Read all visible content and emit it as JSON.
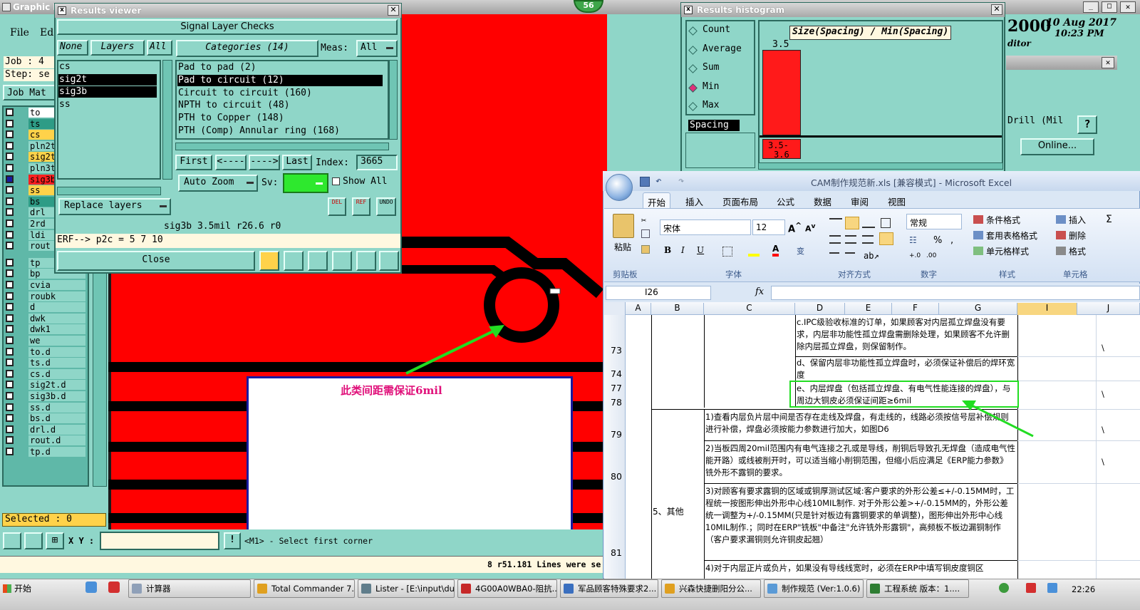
{
  "genesis": {
    "title": "Graphic E",
    "menu": [
      "File",
      "Ed"
    ],
    "job_label": "Job : 4",
    "step_label": "Step: se",
    "job_matrix": "Job Mat",
    "date": "10 Aug 2017",
    "time": "10:23 PM",
    "year_big": "2000",
    "editor": "ditor",
    "drill_label": "Drill (Mil",
    "help": "?",
    "online": "Online...",
    "selected": "Selected : 0",
    "xy_label": "X Y :",
    "prompt": "<M1> - Select first corner",
    "status_msg": "8 r51.181 Lines were se",
    "badge": "56",
    "excl": "!",
    "layers": [
      "to",
      "ts",
      "cs",
      "pln2t",
      "sig2t",
      "pln3t",
      "sig3b",
      "ss",
      "bs",
      "drl",
      "2rd",
      "ldi",
      "rout",
      "tp",
      "bp",
      "cvia",
      "roubk",
      "d",
      "dwk",
      "dwk1",
      "we",
      "to.d",
      "ts.d",
      "cs.d",
      "sig2t.d",
      "sig3b.d",
      "ss.d",
      "bs.d",
      "drl.d",
      "rout.d",
      "tp.d"
    ],
    "layer_colors": [
      "#ffffff",
      "#2e9c86",
      "#ffd24a",
      "#8fd6c8",
      "#ffd24a",
      "#8fd6c8",
      "#ff2020",
      "#ffd24a",
      "#2e9c86",
      "#8fd6c8",
      "#8fd6c8",
      "#8fd6c8",
      "#8fd6c8",
      "#8fd6c8",
      "#8fd6c8",
      "#8fd6c8",
      "#8fd6c8",
      "#8fd6c8",
      "#8fd6c8",
      "#8fd6c8",
      "#8fd6c8",
      "#8fd6c8",
      "#8fd6c8",
      "#8fd6c8",
      "#8fd6c8",
      "#8fd6c8",
      "#8fd6c8",
      "#8fd6c8",
      "#8fd6c8",
      "#8fd6c8",
      "#8fd6c8"
    ],
    "annotation": "此类间距需保证6mil"
  },
  "results": {
    "title": "Results viewer",
    "header": "Signal Layer Checks",
    "none": "None",
    "layers": "Layers",
    "all": "All",
    "categories": "Categories (14)",
    "meas": "Meas:",
    "meas_val": "All",
    "layer_items": [
      "cs",
      "sig2t",
      "sig3b",
      "ss"
    ],
    "cat_items": [
      "Pad to pad (2)",
      "Pad to circuit (12)",
      "Circuit to circuit (160)",
      "NPTH to circuit (48)",
      "PTH to Copper (148)",
      "PTH (Comp) Annular ring (168)"
    ],
    "first": "First",
    "prev": "<----",
    "next": "---->",
    "last": "Last",
    "index_label": "Index:",
    "index_val": "3665",
    "auto_zoom": "Auto Zoom",
    "sv": "Sv:",
    "show_all": "Show All",
    "replace": "Replace layers",
    "del": "DEL",
    "ref": "REF",
    "undo": "UNDO",
    "status": "sig3b 3.5mil  r26.6  r0",
    "erf": "ERF--> p2c = 5 7 10",
    "close": "Close"
  },
  "histogram": {
    "title": "Results histogram",
    "options": [
      "Count",
      "Average",
      "Sum",
      "Min",
      "Max"
    ],
    "selected": "Min",
    "spacing": "Spacing",
    "chart_title": "Size(Spacing) / Min(Spacing)",
    "bar_value": "3.5",
    "bin_label1": "3.5-",
    "bin_label2": "3.6"
  },
  "excel": {
    "title": "CAM制作规范新.xls [兼容模式] - Microsoft Excel",
    "tabs": [
      "开始",
      "插入",
      "页面布局",
      "公式",
      "数据",
      "审阅",
      "视图"
    ],
    "paste": "粘贴",
    "font_name": "宋体",
    "font_size": "12",
    "number_format": "常规",
    "styles": [
      "条件格式",
      "套用表格格式",
      "单元格样式"
    ],
    "cells": [
      "插入",
      "删除",
      "格式"
    ],
    "groups": [
      "剪贴板",
      "字体",
      "对齐方式",
      "数字",
      "样式",
      "单元格"
    ],
    "name_box": "I26",
    "fx": "fx",
    "columns": [
      "A",
      "B",
      "C",
      "D",
      "E",
      "F",
      "G",
      "I",
      "J"
    ],
    "rows": [
      {
        "num": "73",
        "text": "c.IPC级验收标准的订单，如果顾客对内层孤立焊盘没有要求，内层非功能性孤立焊盘需删除处理，如果顾客不允许删除内层孤立焊盘，则保留制作。",
        "j": "\\"
      },
      {
        "num": "74",
        "text": "d、保留内层非功能性孤立焊盘时，必须保证补偿后的焊环宽度",
        "j": ""
      },
      {
        "num": "77",
        "text": "e、内层焊盘（包括孤立焊盘、有电气性能连接的焊盘），与周边大铜皮必须保证间距≥6mil",
        "j": "\\"
      },
      {
        "num": "79",
        "text": "1)查看内层负片层中间是否存在走线及焊盘，有走线的，线路必须按信号层补偿规则进行补偿，焊盘必须按能力参数进行加大，如图D6",
        "j": "\\"
      },
      {
        "num": "80",
        "text": "2)当板四周20mil范围内有电气连接之孔或是导线，削铜后导致孔无焊盘（造成电气性能开路）或线被削开时，可以适当缩小削铜范围，但缩小后应满足《ERP能力参数》铣外形不露铜的要求。",
        "j": "\\"
      },
      {
        "num": "81",
        "text": "3)对顾客有要求露铜的区域或铜厚测试区域:客户要求的外形公差≤+/-0.15MM时，工程统一按图形伸出外形中心线10MIL制作. 对于外形公差>+/-0.15MM的，外形公差统一调整为+/-0.15MM(只是针对板边有露铜要求的单调整)，图形伸出外形中心线10MIL制作.；同时在ERP\"铣板\"中备注\"允许铣外形露铜\"，高频板不板边漏铜制作（客户要求漏铜则允许铜皮起翘）",
        "j": ""
      },
      {
        "num": "",
        "text": "4)对于内层正片或负片，如果没有导线线宽时，必须在ERP中填写铜皮度铜区",
        "j": ""
      }
    ],
    "b_cell": "5、其他",
    "row_labels_extra": [
      "78"
    ]
  },
  "taskbar": {
    "start": "开始",
    "items": [
      "计算器",
      "Total Commander 7.0...",
      "Lister - [E:\\input\\duo...",
      "4G00A0WBA0-阻抗...",
      "军品顾客特殊要求2...",
      "兴森快捷删阳分公...",
      "制作规范 (Ver:1.0.6)",
      "工程系统  版本：1...."
    ],
    "time": "22:26"
  }
}
